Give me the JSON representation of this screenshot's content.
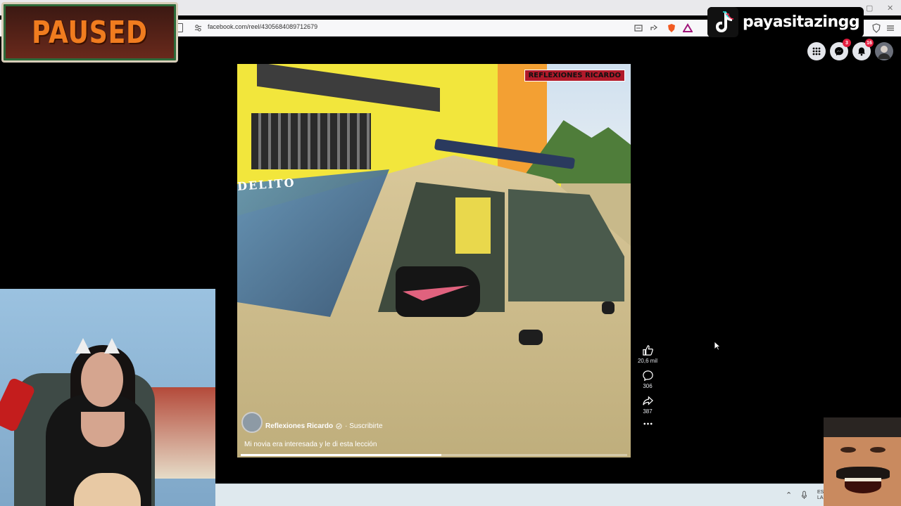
{
  "browser": {
    "url": "facebook.com/reel/4305684089712679"
  },
  "overlays": {
    "paused_text": "PAUSED",
    "tiktok_handle": "payasitazingg"
  },
  "fb_header": {
    "messenger_badge": "3",
    "notifications_badge": "16"
  },
  "reel": {
    "watermark": "REFLEXIONES RICARDO",
    "window_text": "DELITO",
    "author": "Reflexiones Ricardo",
    "subscribe": "· Suscribirte",
    "caption": "Mi novia era interesada y le di esta lección",
    "progress": 0.52
  },
  "actions": {
    "likes": "20,6 mil",
    "comments": "306",
    "shares": "387"
  },
  "taskbar": {
    "lang1": "ES",
    "lang2": "LA"
  },
  "colors": {
    "facebook_bg": "#000000",
    "badge_red": "#e41e3f",
    "paused_orange": "#f07c1f"
  }
}
